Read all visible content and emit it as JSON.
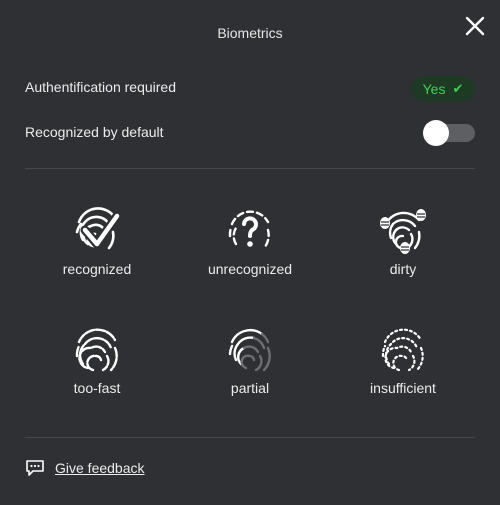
{
  "dialog": {
    "title": "Biometrics",
    "close_icon": "close-icon"
  },
  "settings": {
    "auth_required": {
      "label": "Authentification required",
      "value": "Yes",
      "value_icon": "checkmark-icon",
      "value_color": "#3fd34d"
    },
    "recognized_default": {
      "label": "Recognized by default",
      "enabled": false
    }
  },
  "fingerprints": [
    {
      "label": "recognized",
      "icon": "fingerprint-check-icon"
    },
    {
      "label": "unrecognized",
      "icon": "fingerprint-question-icon"
    },
    {
      "label": "dirty",
      "icon": "fingerprint-bugs-icon"
    },
    {
      "label": "too-fast",
      "icon": "fingerprint-dashed-icon"
    },
    {
      "label": "partial",
      "icon": "fingerprint-partial-icon"
    },
    {
      "label": "insufficient",
      "icon": "fingerprint-dotted-icon"
    }
  ],
  "footer": {
    "feedback_label": "Give feedback",
    "feedback_icon": "comment-icon"
  },
  "colors": {
    "background": "#2e3033",
    "text": "#ececec",
    "accent_green": "#3fd34d"
  }
}
